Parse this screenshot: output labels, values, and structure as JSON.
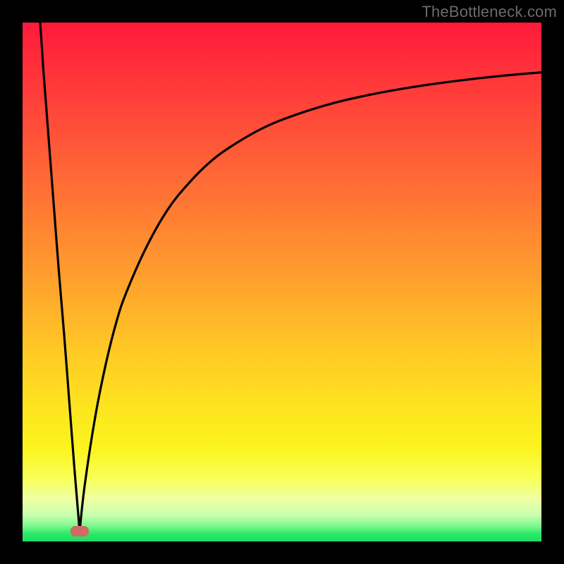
{
  "watermark": "TheBottleneck.com",
  "chart_data": {
    "type": "line",
    "title": "",
    "xlabel": "",
    "ylabel": "",
    "xlim": [
      0,
      100
    ],
    "ylim": [
      0,
      100
    ],
    "background": "red-yellow-green vertical gradient (bottleneck heatmap)",
    "optimum_x": 11,
    "series": [
      {
        "name": "left-branch",
        "x": [
          3.4,
          4,
          5,
          6,
          7,
          8,
          9,
          10,
          11
        ],
        "values": [
          100,
          91,
          78,
          65,
          52,
          40,
          27,
          14,
          2
        ]
      },
      {
        "name": "right-branch",
        "x": [
          11,
          12,
          14,
          16,
          18,
          20,
          24,
          28,
          32,
          36,
          40,
          46,
          52,
          60,
          68,
          76,
          84,
          92,
          100
        ],
        "values": [
          2,
          11,
          24,
          34,
          42,
          48,
          57,
          64,
          69,
          73,
          76,
          79.5,
          82,
          84.5,
          86.3,
          87.7,
          88.8,
          89.7,
          90.4
        ]
      }
    ],
    "annotations": [
      {
        "name": "optimum-marker",
        "x": 11,
        "y": 2,
        "shape": "rounded-rect",
        "color": "#d06a62"
      }
    ]
  },
  "colors": {
    "frame": "#000000",
    "curve": "#000000",
    "marker": "#d06a62",
    "watermark": "#6b6b6b"
  }
}
